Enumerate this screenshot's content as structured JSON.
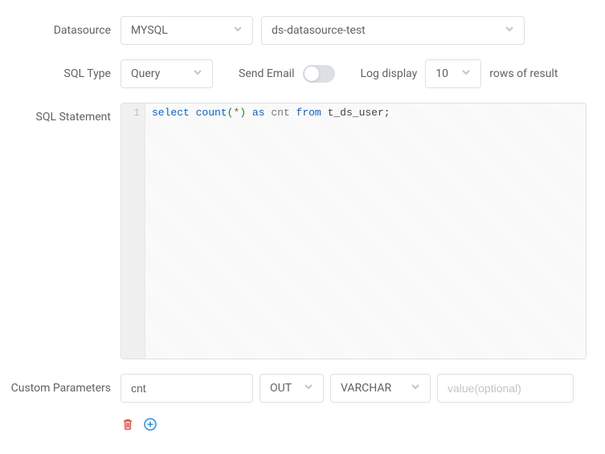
{
  "datasource": {
    "label": "Datasource",
    "type": "MYSQL",
    "name": "ds-datasource-test"
  },
  "sqlType": {
    "label": "SQL Type",
    "value": "Query"
  },
  "sendEmail": {
    "label": "Send Email",
    "enabled": false
  },
  "logDisplay": {
    "label": "Log display",
    "value": "10",
    "suffix": "rows of result"
  },
  "sqlStatement": {
    "label": "SQL Statement",
    "lineNumber": "1",
    "tokens": {
      "t1": "select",
      "t2": "count",
      "t3": "(",
      "t4": "*",
      "t5": ")",
      "t6": "as",
      "t7": "cnt",
      "t8": "from",
      "t9": "t_ds_user;"
    }
  },
  "customParameters": {
    "label": "Custom Parameters",
    "params": [
      {
        "name": "cnt",
        "direction": "OUT",
        "type": "VARCHAR",
        "valuePlaceholder": "value(optional)",
        "value": ""
      }
    ]
  }
}
